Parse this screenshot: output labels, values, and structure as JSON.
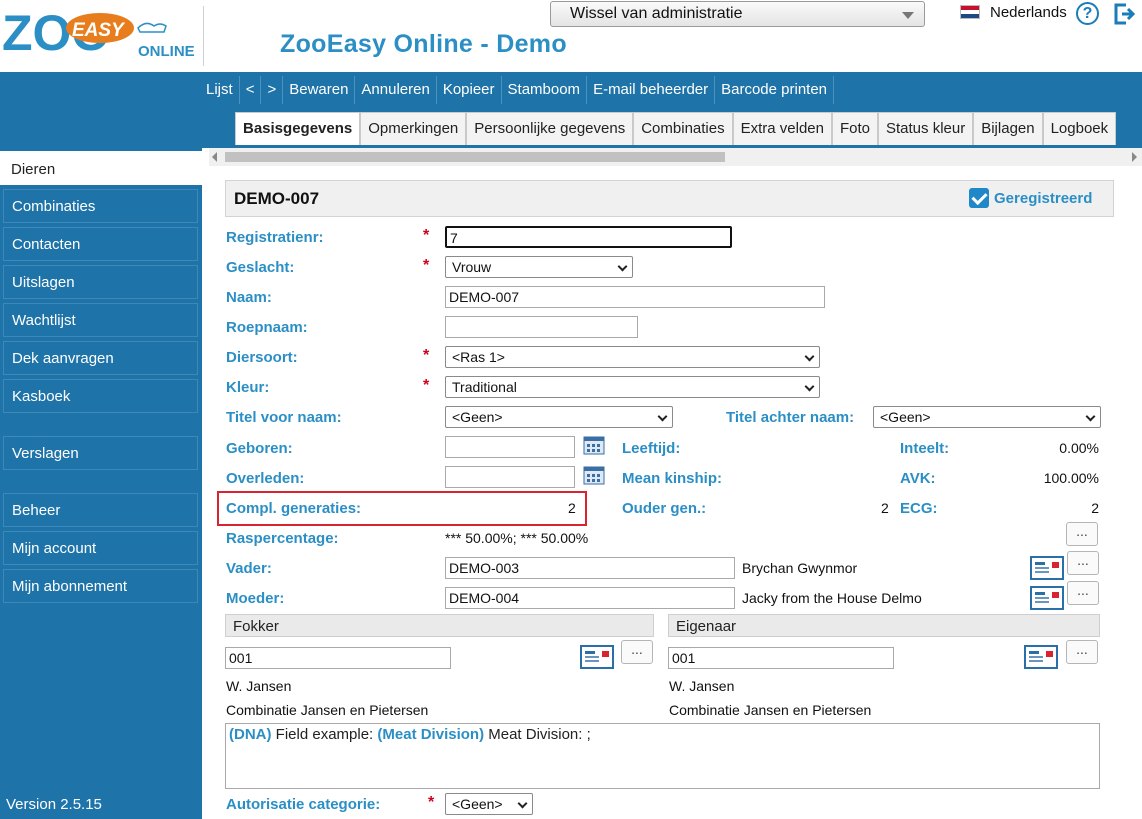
{
  "header": {
    "logo_zoo": "ZOO",
    "logo_easy": "EASY",
    "logo_online": "ONLINE",
    "app_title": "ZooEasy Online - Demo",
    "admin_select": "Wissel van administratie",
    "language": "Nederlands"
  },
  "toolbar": [
    "Lijst",
    "<",
    ">",
    "Bewaren",
    "Annuleren",
    "Kopieer",
    "Stamboom",
    "E-mail beheerder",
    "Barcode printen"
  ],
  "tabs": [
    "Basisgegevens",
    "Opmerkingen",
    "Persoonlijke gegevens",
    "Combinaties",
    "Extra velden",
    "Foto",
    "Status kleur",
    "Bijlagen",
    "Logboek"
  ],
  "sidebar": {
    "items": [
      "Dieren",
      "Combinaties",
      "Contacten",
      "Uitslagen",
      "Wachtlijst",
      "Dek aanvragen",
      "Kasboek",
      "Verslagen",
      "Beheer",
      "Mijn account",
      "Mijn abonnement"
    ],
    "active": "Dieren",
    "version": "Version 2.5.15"
  },
  "record": {
    "title": "DEMO-007",
    "registered_label": "Geregistreerd",
    "registered": true
  },
  "form": {
    "registratienr": {
      "label": "Registratienr:",
      "value": "7"
    },
    "geslacht": {
      "label": "Geslacht:",
      "value": "Vrouw"
    },
    "naam": {
      "label": "Naam:",
      "value": "DEMO-007"
    },
    "roepnaam": {
      "label": "Roepnaam:",
      "value": ""
    },
    "diersoort": {
      "label": "Diersoort:",
      "value": "<Ras 1>"
    },
    "kleur": {
      "label": "Kleur:",
      "value": "Traditional"
    },
    "titel_voor": {
      "label": "Titel voor naam:",
      "value": "<Geen>"
    },
    "titel_achter": {
      "label": "Titel achter naam:",
      "value": "<Geen>"
    },
    "geboren": {
      "label": "Geboren:",
      "value": ""
    },
    "overleden": {
      "label": "Overleden:",
      "value": ""
    },
    "leeftijd": {
      "label": "Leeftijd:",
      "value": ""
    },
    "mean_kinship": {
      "label": "Mean kinship:",
      "value": ""
    },
    "inteelt": {
      "label": "Inteelt:",
      "value": "0.00%"
    },
    "avk": {
      "label": "AVK:",
      "value": "100.00%"
    },
    "compl_generaties": {
      "label": "Compl. generaties:",
      "value": "2"
    },
    "ouder_gen": {
      "label": "Ouder gen.:",
      "value": "2"
    },
    "ecg": {
      "label": "ECG:",
      "value": "2"
    },
    "raspercentage": {
      "label": "Raspercentage:",
      "value": "*** 50.00%; *** 50.00%"
    },
    "vader": {
      "label": "Vader:",
      "value": "DEMO-003",
      "name": "Brychan Gwynmor"
    },
    "moeder": {
      "label": "Moeder:",
      "value": "DEMO-004",
      "name": "Jacky from the House Delmo"
    },
    "fokker": {
      "label": "Fokker",
      "value": "001",
      "name": "W. Jansen",
      "combination": "Combinatie Jansen en Pietersen"
    },
    "eigenaar": {
      "label": "Eigenaar",
      "value": "001",
      "name": "W. Jansen",
      "combination": "Combinatie Jansen en Pietersen"
    },
    "notes": {
      "tag1": "(DNA)",
      "text1": "Field example:",
      "tag2": "(Meat Division)",
      "text2": "Meat Division: ;"
    },
    "autorisatie": {
      "label": "Autorisatie categorie:",
      "value": "<Geen>"
    }
  },
  "dots_label": "...",
  "required_mark": "*",
  "colors": {
    "brand_blue": "#1e73a8",
    "label_blue": "#2b8fc6",
    "highlight_red": "#d9232e"
  }
}
